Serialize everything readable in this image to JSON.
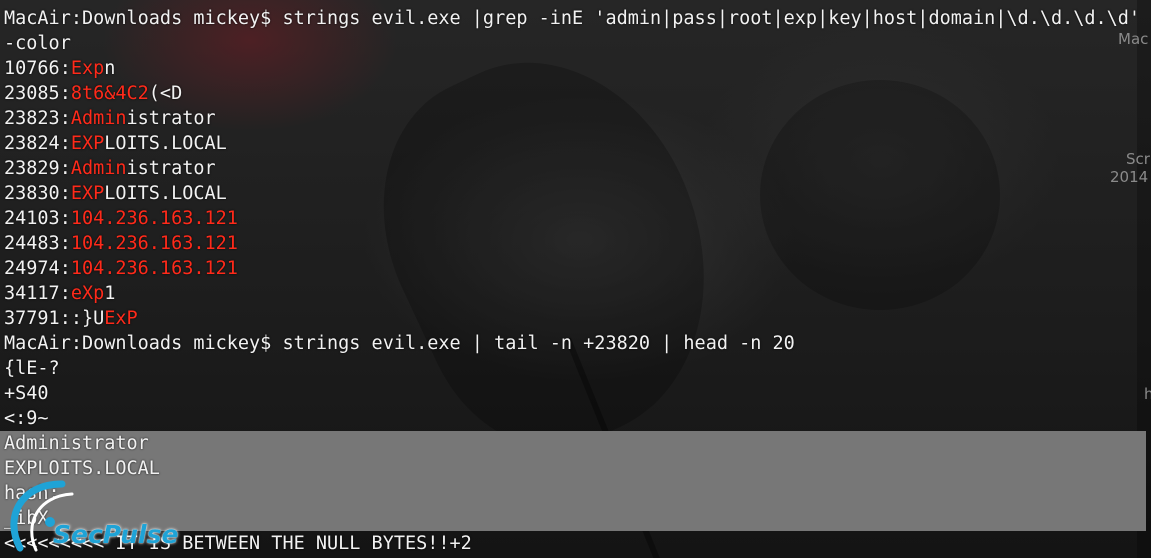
{
  "background_side_labels": [
    "Mac",
    "Scr",
    "2014",
    "h"
  ],
  "watermark": "SecPulse",
  "lines": [
    {
      "segments": [
        {
          "t": "MacAir:Downloads mickey$ strings evil.exe |grep -inE 'admin|pass|root|exp|key|host|domain|\\d.\\d.\\d.\\d' -",
          "h": false
        }
      ]
    },
    {
      "segments": [
        {
          "t": "-color",
          "h": false
        }
      ]
    },
    {
      "segments": [
        {
          "t": "10766:",
          "h": false
        },
        {
          "t": "Exp",
          "h": true
        },
        {
          "t": "n",
          "h": false
        }
      ]
    },
    {
      "segments": [
        {
          "t": "23085:",
          "h": false
        },
        {
          "t": "8t6&4C2",
          "h": true
        },
        {
          "t": "(<D",
          "h": false
        }
      ]
    },
    {
      "segments": [
        {
          "t": "23823:",
          "h": false
        },
        {
          "t": "Admin",
          "h": true
        },
        {
          "t": "istrator",
          "h": false
        }
      ]
    },
    {
      "segments": [
        {
          "t": "23824:",
          "h": false
        },
        {
          "t": "EXP",
          "h": true
        },
        {
          "t": "LOITS.LOCAL",
          "h": false
        }
      ]
    },
    {
      "segments": [
        {
          "t": "23829:",
          "h": false
        },
        {
          "t": "Admin",
          "h": true
        },
        {
          "t": "istrator",
          "h": false
        }
      ]
    },
    {
      "segments": [
        {
          "t": "23830:",
          "h": false
        },
        {
          "t": "EXP",
          "h": true
        },
        {
          "t": "LOITS.LOCAL",
          "h": false
        }
      ]
    },
    {
      "segments": [
        {
          "t": "24103:",
          "h": false
        },
        {
          "t": "104.236.163.121",
          "h": true
        }
      ]
    },
    {
      "segments": [
        {
          "t": "24483:",
          "h": false
        },
        {
          "t": "104.236.163.121",
          "h": true
        }
      ]
    },
    {
      "segments": [
        {
          "t": "24974:",
          "h": false
        },
        {
          "t": "104.236.163.121",
          "h": true
        }
      ]
    },
    {
      "segments": [
        {
          "t": "34117:",
          "h": false
        },
        {
          "t": "eXp",
          "h": true
        },
        {
          "t": "1",
          "h": false
        }
      ]
    },
    {
      "segments": [
        {
          "t": "37791:",
          "h": false
        },
        {
          "t": ":}U",
          "h": false
        },
        {
          "t": "ExP",
          "h": true
        }
      ]
    },
    {
      "segments": [
        {
          "t": "MacAir:Downloads mickey$ strings evil.exe | tail -n +23820 | head -n 20",
          "h": false
        }
      ]
    },
    {
      "segments": [
        {
          "t": "{lE-?",
          "h": false
        }
      ]
    },
    {
      "segments": [
        {
          "t": "+S40",
          "h": false
        }
      ]
    },
    {
      "segments": [
        {
          "t": "<:9~",
          "h": false
        }
      ]
    },
    {
      "segments": [
        {
          "t": "Administrator",
          "h": false
        }
      ]
    },
    {
      "segments": [
        {
          "t": "EXPLOITS.LOCAL",
          "h": false
        }
      ]
    },
    {
      "segments": [
        {
          "t": "hash:",
          "h": false
        }
      ]
    },
    {
      "segments": [
        {
          "t": "_ibX",
          "h": false
        }
      ]
    },
    {
      "segments": [
        {
          "t": "<<<<<<<<< IT IS BETWEEN THE NULL BYTES!!+2",
          "h": false
        }
      ]
    }
  ],
  "colors": {
    "highlight": "#ff2a1a",
    "text": "#f2f2f2",
    "selection": "#777777"
  }
}
